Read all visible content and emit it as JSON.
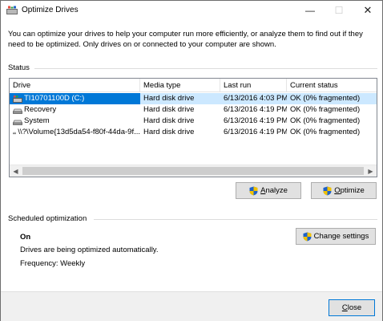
{
  "window": {
    "title": "Optimize Drives",
    "minimize_glyph": "—",
    "maximize_glyph": "☐",
    "close_glyph": "✕"
  },
  "description": "You can optimize your drives to help your computer run more efficiently, or analyze them to find out if they need to be optimized. Only drives on or connected to your computer are shown.",
  "status": {
    "label": "Status",
    "columns": [
      "Drive",
      "Media type",
      "Last run",
      "Current status"
    ],
    "drives": [
      {
        "name": "TI10701100D (C:)",
        "media": "Hard disk drive",
        "last_run": "6/13/2016 4:03 PM",
        "status": "OK (0% fragmented)",
        "icon": "windows-drive-icon",
        "selected": true
      },
      {
        "name": "Recovery",
        "media": "Hard disk drive",
        "last_run": "6/13/2016 4:19 PM",
        "status": "OK (0% fragmented)",
        "icon": "drive-icon",
        "selected": false
      },
      {
        "name": "System",
        "media": "Hard disk drive",
        "last_run": "6/13/2016 4:19 PM",
        "status": "OK (0% fragmented)",
        "icon": "drive-icon",
        "selected": false
      },
      {
        "name": "\\\\?\\Volume{13d5da54-f80f-44da-9f...",
        "media": "Hard disk drive",
        "last_run": "6/13/2016 4:19 PM",
        "status": "OK (0% fragmented)",
        "icon": "drive-icon",
        "selected": false
      }
    ],
    "analyze_mnemonic": "A",
    "analyze_rest": "nalyze",
    "optimize_mnemonic": "O",
    "optimize_rest": "ptimize"
  },
  "scheduled": {
    "label": "Scheduled optimization",
    "state": "On",
    "message": "Drives are being optimized automatically.",
    "frequency": "Frequency: Weekly",
    "change_settings_label": "Change settings"
  },
  "footer": {
    "close_mnemonic": "C",
    "close_rest": "lose"
  },
  "colors": {
    "selection": "#0078d7",
    "row_highlight": "#cce8ff",
    "shield_blue": "#1e62c9",
    "shield_yellow": "#f2c200"
  }
}
